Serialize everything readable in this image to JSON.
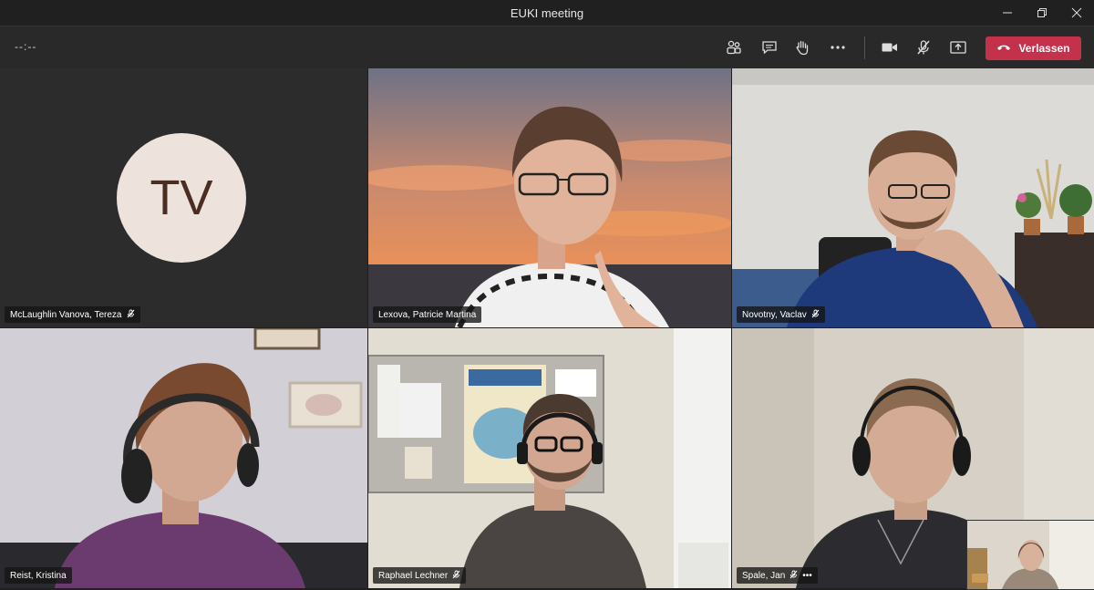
{
  "window": {
    "title": "EUKI meeting"
  },
  "toolbar": {
    "timer": "--:--",
    "leave_label": "Verlassen"
  },
  "participants": [
    {
      "name": "McLaughlin Vanova, Tereza",
      "initials": "TV",
      "muted": true
    },
    {
      "name": "Lexova, Patricie Martina",
      "muted": false
    },
    {
      "name": "Novotny, Vaclav",
      "muted": true
    },
    {
      "name": "Reist, Kristina",
      "muted": false
    },
    {
      "name": "Raphael Lechner",
      "muted": true
    },
    {
      "name": "Spale, Jan",
      "muted": true,
      "more": "•••"
    }
  ],
  "colors": {
    "leave": "#c4314b",
    "avatar_bg": "#ede3dc",
    "avatar_text": "#4a2e24"
  }
}
